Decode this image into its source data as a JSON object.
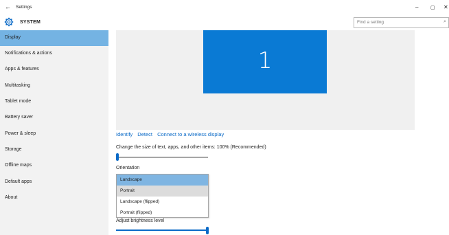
{
  "window": {
    "title": "Settings",
    "back_icon": "back-arrow-icon",
    "minimize": "–",
    "maximize": "▢",
    "close": "✕"
  },
  "header": {
    "app_name": "SYSTEM",
    "icon": "gear-icon",
    "search_placeholder": "Find a setting",
    "search_icon": "search-icon"
  },
  "sidebar": {
    "items": [
      {
        "label": "Display",
        "active": true
      },
      {
        "label": "Notifications & actions"
      },
      {
        "label": "Apps & features"
      },
      {
        "label": "Multitasking"
      },
      {
        "label": "Tablet mode"
      },
      {
        "label": "Battery saver"
      },
      {
        "label": "Power & sleep"
      },
      {
        "label": "Storage"
      },
      {
        "label": "Offline maps"
      },
      {
        "label": "Default apps"
      },
      {
        "label": "About"
      }
    ]
  },
  "display": {
    "monitor_number": "1",
    "links": [
      "Identify",
      "Detect",
      "Connect to a wireless display"
    ],
    "scale_label": "Change the size of text, apps, and other items: 100% (Recommended)",
    "scale_value_fraction": 0,
    "orientation_label": "Orientation",
    "orientation_options": [
      "Landscape",
      "Portrait",
      "Landscape (flipped)",
      "Portrait (flipped)"
    ],
    "orientation_selected": "Landscape",
    "brightness_label": "Adjust brightness level",
    "brightness_value_fraction": 1
  },
  "colors": {
    "accent": "#0a7ad4",
    "sidebar_active": "#74b3e3",
    "link": "#0a6ac7"
  }
}
